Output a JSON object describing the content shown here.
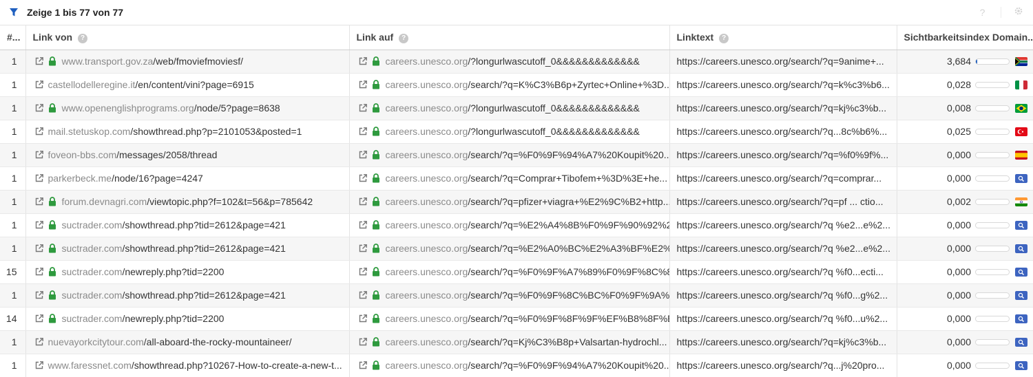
{
  "header": {
    "title": "Zeige 1 bis 77 von 77",
    "filter_icon": "filter-icon",
    "help_label": "?",
    "settings_icon": "gear-icon"
  },
  "columns": {
    "count": "#...",
    "link_from": "Link von",
    "link_to": "Link auf",
    "linktext": "Linktext",
    "visibility": "Sichtbarkeitsindex Domain..."
  },
  "colors": {
    "accent": "#1f5fbf",
    "lock": "#2e9a3e"
  },
  "rows": [
    {
      "count": "1",
      "from_secure": true,
      "from_domain": "www.transport.gov.za",
      "from_path": "/web/fmoviefmoviesf/",
      "to_domain": "careers.unesco.org",
      "to_path": "/?longurlwascutoff_0&&&&&&&&&&&&&",
      "text": "https://careers.unesco.org/search/?q=9anime+...",
      "vi": "3,684",
      "vi_fraction": 0.04,
      "country": "za"
    },
    {
      "count": "1",
      "from_secure": false,
      "from_domain": "castellodelleregine.it",
      "from_path": "/en/content/vini?page=6915",
      "to_domain": "careers.unesco.org",
      "to_path": "/search/?q=K%C3%B6p+Zyrtec+Online+%3D...",
      "text": "https://careers.unesco.org/search/?q=k%c3%b6...",
      "vi": "0,028",
      "vi_fraction": 0,
      "country": "it"
    },
    {
      "count": "1",
      "from_secure": true,
      "from_domain": "www.openenglishprograms.org",
      "from_path": "/node/5?page=8638",
      "to_domain": "careers.unesco.org",
      "to_path": "/?longurlwascutoff_0&&&&&&&&&&&&&",
      "text": "https://careers.unesco.org/search/?q=kj%c3%b...",
      "vi": "0,008",
      "vi_fraction": 0,
      "country": "br"
    },
    {
      "count": "1",
      "from_secure": false,
      "from_domain": "mail.stetuskop.com",
      "from_path": "/showthread.php?p=2101053&posted=1",
      "to_domain": "careers.unesco.org",
      "to_path": "/?longurlwascutoff_0&&&&&&&&&&&&&",
      "text": "https://careers.unesco.org/search/?q...8c%b6%...",
      "vi": "0,025",
      "vi_fraction": 0,
      "country": "tr"
    },
    {
      "count": "1",
      "from_secure": false,
      "from_domain": "foveon-bbs.com",
      "from_path": "/messages/2058/thread",
      "to_domain": "careers.unesco.org",
      "to_path": "/search/?q=%F0%9F%94%A7%20Koupit%20...",
      "text": "https://careers.unesco.org/search/?q=%f0%9f%...",
      "vi": "0,000",
      "vi_fraction": 0,
      "country": "es"
    },
    {
      "count": "1",
      "from_secure": false,
      "from_domain": "parkerbeck.me",
      "from_path": "/node/16?page=4247",
      "to_domain": "careers.unesco.org",
      "to_path": "/search/?q=Comprar+Tibofem+%3D%3E+he...",
      "text": "https://careers.unesco.org/search/?q=comprar...",
      "vi": "0,000",
      "vi_fraction": 0,
      "country": "search"
    },
    {
      "count": "1",
      "from_secure": true,
      "from_domain": "forum.devnagri.com",
      "from_path": "/viewtopic.php?f=102&t=56&p=785642",
      "to_domain": "careers.unesco.org",
      "to_path": "/search/?q=pfizer+viagra+%E2%9C%B2+http...",
      "text": "https://careers.unesco.org/search/?q=pf ... ctio...",
      "vi": "0,002",
      "vi_fraction": 0,
      "country": "in"
    },
    {
      "count": "1",
      "from_secure": true,
      "from_domain": "suctrader.com",
      "from_path": "/showthread.php?tid=2612&page=421",
      "to_domain": "careers.unesco.org",
      "to_path": "/search/?q=%E2%A4%8B%F0%9F%90%92%2...",
      "text": "https://careers.unesco.org/search/?q %e2...e%2...",
      "vi": "0,000",
      "vi_fraction": 0,
      "country": "search"
    },
    {
      "count": "1",
      "from_secure": true,
      "from_domain": "suctrader.com",
      "from_path": "/showthread.php?tid=2612&page=421",
      "to_domain": "careers.unesco.org",
      "to_path": "/search/?q=%E2%A0%BC%E2%A3%BF%E2%...",
      "text": "https://careers.unesco.org/search/?q %e2...e%2...",
      "vi": "0,000",
      "vi_fraction": 0,
      "country": "search"
    },
    {
      "count": "15",
      "from_secure": true,
      "from_domain": "suctrader.com",
      "from_path": "/newreply.php?tid=2200",
      "to_domain": "careers.unesco.org",
      "to_path": "/search/?q=%F0%9F%A7%89%F0%9F%8C%8...",
      "text": "https://careers.unesco.org/search/?q %f0...ecti...",
      "vi": "0,000",
      "vi_fraction": 0,
      "country": "search"
    },
    {
      "count": "1",
      "from_secure": true,
      "from_domain": "suctrader.com",
      "from_path": "/showthread.php?tid=2612&page=421",
      "to_domain": "careers.unesco.org",
      "to_path": "/search/?q=%F0%9F%8C%BC%F0%9F%9A%...",
      "text": "https://careers.unesco.org/search/?q %f0...g%2...",
      "vi": "0,000",
      "vi_fraction": 0,
      "country": "search"
    },
    {
      "count": "14",
      "from_secure": true,
      "from_domain": "suctrader.com",
      "from_path": "/newreply.php?tid=2200",
      "to_domain": "careers.unesco.org",
      "to_path": "/search/?q=%F0%9F%8F%9F%EF%B8%8F%E...",
      "text": "https://careers.unesco.org/search/?q %f0...u%2...",
      "vi": "0,000",
      "vi_fraction": 0,
      "country": "search"
    },
    {
      "count": "1",
      "from_secure": false,
      "from_domain": "nuevayorkcitytour.com",
      "from_path": "/all-aboard-the-rocky-mountaineer/",
      "to_domain": "careers.unesco.org",
      "to_path": "/search/?q=Kj%C3%B8p+Valsartan-hydrochl...",
      "text": "https://careers.unesco.org/search/?q=kj%c3%b...",
      "vi": "0,000",
      "vi_fraction": 0,
      "country": "search"
    },
    {
      "count": "1",
      "from_secure": false,
      "from_domain": "www.faressnet.com",
      "from_path": "/showthread.php?10267-How-to-create-a-new-t...",
      "to_domain": "careers.unesco.org",
      "to_path": "/search/?q=%F0%9F%94%A7%20Koupit%20...",
      "text": "https://careers.unesco.org/search/?q...j%20pro...",
      "vi": "0,000",
      "vi_fraction": 0,
      "country": "search"
    }
  ]
}
